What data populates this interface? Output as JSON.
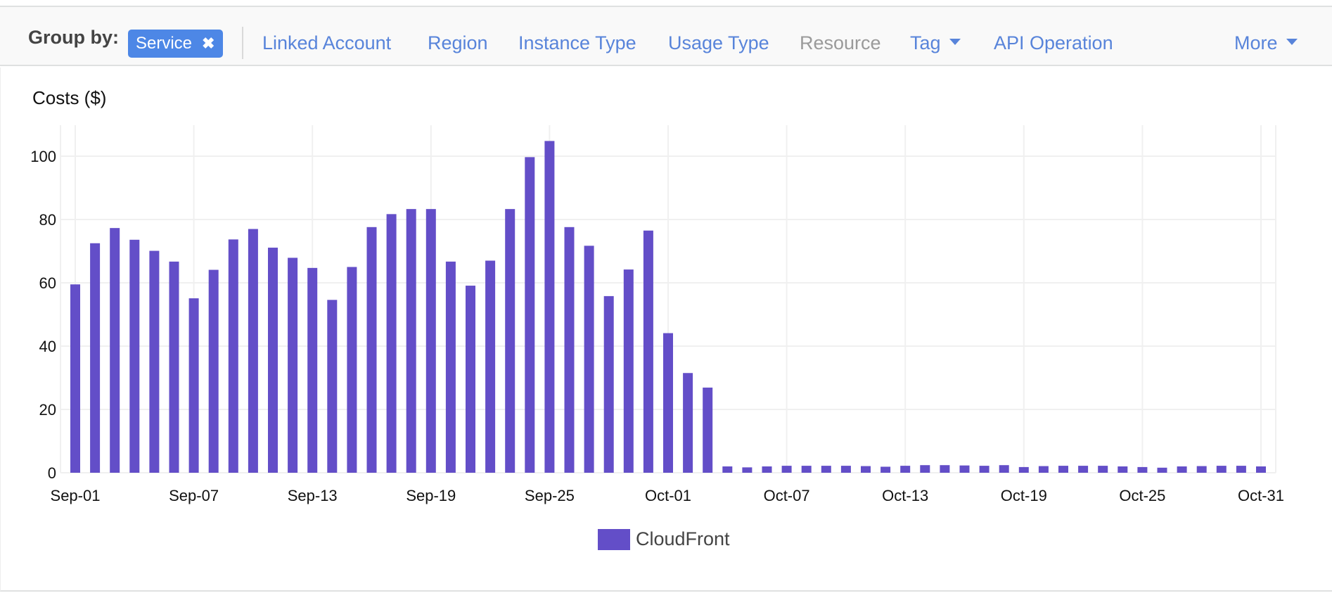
{
  "group_by": {
    "label": "Group by:",
    "selected_chip": {
      "label": "Service",
      "remove_icon": "close-icon",
      "glyph": "✖"
    },
    "options": [
      {
        "label": "Linked Account",
        "enabled": true,
        "dropdown": false
      },
      {
        "label": "Region",
        "enabled": true,
        "dropdown": false
      },
      {
        "label": "Instance Type",
        "enabled": true,
        "dropdown": false
      },
      {
        "label": "Usage Type",
        "enabled": true,
        "dropdown": false
      },
      {
        "label": "Resource",
        "enabled": false,
        "dropdown": false
      },
      {
        "label": "Tag",
        "enabled": true,
        "dropdown": true
      },
      {
        "label": "API Operation",
        "enabled": true,
        "dropdown": false
      }
    ],
    "more": {
      "label": "More",
      "dropdown": true
    }
  },
  "colors": {
    "accent": "#4d87e6",
    "link": "#5884da",
    "bar": "#634ec8",
    "grid": "#f0f0f0"
  },
  "chart_data": {
    "type": "bar",
    "title": "Costs ($)",
    "xlabel": "",
    "ylabel": "Costs ($)",
    "ylim": [
      0,
      110
    ],
    "yticks": [
      0,
      20,
      40,
      60,
      80,
      100
    ],
    "xtick_labels": [
      "Sep-01",
      "Sep-07",
      "Sep-13",
      "Sep-19",
      "Sep-25",
      "Oct-01",
      "Oct-07",
      "Oct-13",
      "Oct-19",
      "Oct-25",
      "Oct-31"
    ],
    "grid": true,
    "legend_position": "bottom-center",
    "categories": [
      "Sep-01",
      "Sep-02",
      "Sep-03",
      "Sep-04",
      "Sep-05",
      "Sep-06",
      "Sep-07",
      "Sep-08",
      "Sep-09",
      "Sep-10",
      "Sep-11",
      "Sep-12",
      "Sep-13",
      "Sep-14",
      "Sep-15",
      "Sep-16",
      "Sep-17",
      "Sep-18",
      "Sep-19",
      "Sep-20",
      "Sep-21",
      "Sep-22",
      "Sep-23",
      "Sep-24",
      "Sep-25",
      "Sep-26",
      "Sep-27",
      "Sep-28",
      "Sep-29",
      "Sep-30",
      "Oct-01",
      "Oct-02",
      "Oct-03",
      "Oct-04",
      "Oct-05",
      "Oct-06",
      "Oct-07",
      "Oct-08",
      "Oct-09",
      "Oct-10",
      "Oct-11",
      "Oct-12",
      "Oct-13",
      "Oct-14",
      "Oct-15",
      "Oct-16",
      "Oct-17",
      "Oct-18",
      "Oct-19",
      "Oct-20",
      "Oct-21",
      "Oct-22",
      "Oct-23",
      "Oct-24",
      "Oct-25",
      "Oct-26",
      "Oct-27",
      "Oct-28",
      "Oct-29",
      "Oct-30",
      "Oct-31"
    ],
    "series": [
      {
        "name": "CloudFront",
        "values": [
          59.5,
          72.5,
          77.3,
          73.6,
          70.1,
          66.7,
          55.1,
          64.1,
          73.7,
          77.0,
          71.1,
          67.9,
          64.7,
          54.6,
          65.0,
          77.6,
          81.7,
          83.3,
          83.3,
          66.7,
          59.1,
          67.0,
          83.3,
          99.7,
          104.8,
          77.6,
          71.7,
          55.8,
          64.2,
          76.5,
          44.1,
          31.5,
          26.9,
          2.0,
          1.7,
          2.0,
          2.2,
          2.2,
          2.2,
          2.2,
          2.1,
          1.9,
          2.2,
          2.4,
          2.4,
          2.3,
          2.2,
          2.4,
          1.8,
          2.1,
          2.2,
          2.2,
          2.2,
          2.0,
          1.8,
          1.6,
          2.0,
          2.1,
          2.2,
          2.2,
          2.0
        ]
      }
    ]
  }
}
